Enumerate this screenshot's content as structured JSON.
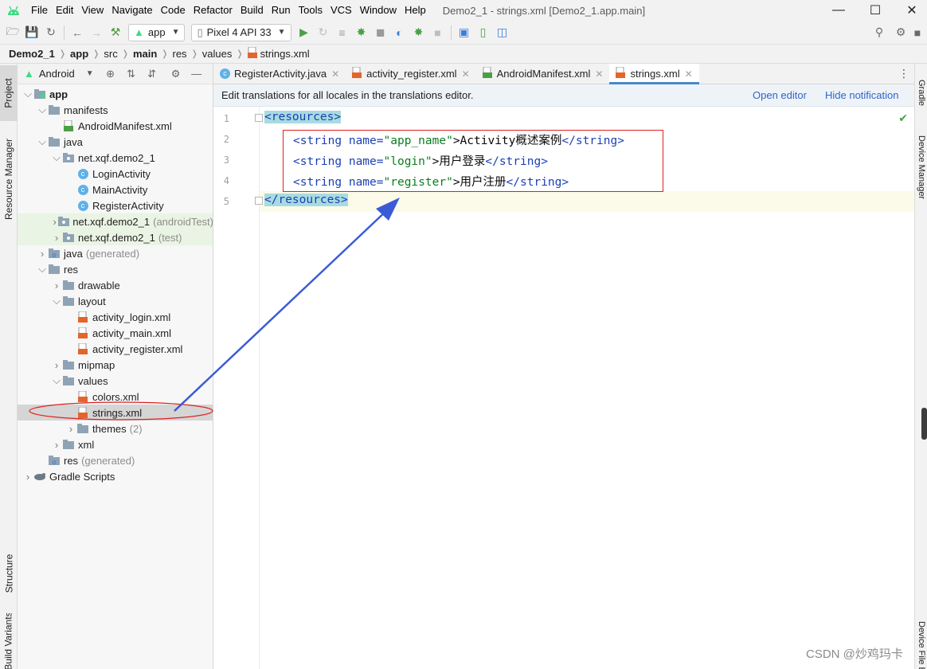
{
  "menu": {
    "items": [
      "File",
      "Edit",
      "View",
      "Navigate",
      "Code",
      "Refactor",
      "Build",
      "Run",
      "Tools",
      "VCS",
      "Window",
      "Help"
    ],
    "window_title": "Demo2_1 - strings.xml [Demo2_1.app.main]"
  },
  "toolbar": {
    "run_config": "app",
    "device": "Pixel 4 API 33"
  },
  "breadcrumb": [
    "Demo2_1",
    "app",
    "src",
    "main",
    "res",
    "values",
    "strings.xml"
  ],
  "left_strip": {
    "project": "Project",
    "resource_manager": "Resource Manager",
    "structure": "Structure",
    "build_variants": "Build Variants"
  },
  "right_strip": {
    "gradle": "Gradle",
    "device_manager": "Device Manager",
    "device_file": "Device File Explorer"
  },
  "project_panel": {
    "view_mode": "Android",
    "tree": [
      {
        "label": "app",
        "bold": true,
        "suffix": ""
      },
      {
        "label": "manifests",
        "suffix": ""
      },
      {
        "label": "AndroidManifest.xml",
        "suffix": ""
      },
      {
        "label": "java",
        "suffix": ""
      },
      {
        "label": "net.xqf.demo2_1",
        "suffix": ""
      },
      {
        "label": "LoginActivity",
        "suffix": ""
      },
      {
        "label": "MainActivity",
        "suffix": ""
      },
      {
        "label": "RegisterActivity",
        "suffix": ""
      },
      {
        "label": "net.xqf.demo2_1",
        "suffix": "(androidTest)"
      },
      {
        "label": "net.xqf.demo2_1",
        "suffix": "(test)"
      },
      {
        "label": "java",
        "suffix": "(generated)"
      },
      {
        "label": "res",
        "suffix": ""
      },
      {
        "label": "drawable",
        "suffix": ""
      },
      {
        "label": "layout",
        "suffix": ""
      },
      {
        "label": "activity_login.xml",
        "suffix": ""
      },
      {
        "label": "activity_main.xml",
        "suffix": ""
      },
      {
        "label": "activity_register.xml",
        "suffix": ""
      },
      {
        "label": "mipmap",
        "suffix": ""
      },
      {
        "label": "values",
        "suffix": ""
      },
      {
        "label": "colors.xml",
        "suffix": ""
      },
      {
        "label": "strings.xml",
        "suffix": ""
      },
      {
        "label": "themes",
        "suffix": "(2)"
      },
      {
        "label": "xml",
        "suffix": ""
      },
      {
        "label": "res",
        "suffix": "(generated)"
      },
      {
        "label": "Gradle Scripts",
        "suffix": ""
      }
    ]
  },
  "tabs": [
    {
      "label": "RegisterActivity.java"
    },
    {
      "label": "activity_register.xml"
    },
    {
      "label": "AndroidManifest.xml"
    },
    {
      "label": "strings.xml"
    }
  ],
  "notification": {
    "message": "Edit translations for all locales in the translations editor.",
    "open_editor": "Open editor",
    "hide": "Hide notification"
  },
  "editor": {
    "line_numbers": [
      "1",
      "2",
      "3",
      "4",
      "5"
    ],
    "resources_tag": "resources",
    "strings": [
      {
        "name": "app_name",
        "value": "Activity概述案例"
      },
      {
        "name": "login",
        "value": "用户登录"
      },
      {
        "name": "register",
        "value": "用户注册"
      }
    ]
  },
  "watermark": "CSDN @炒鸡玛卡",
  "colors": {
    "annotation_red": "#e02020",
    "annotation_arrow": "#3b5bd6",
    "tag_blue": "#1c3fb5",
    "value_green": "#0b7d1f"
  }
}
